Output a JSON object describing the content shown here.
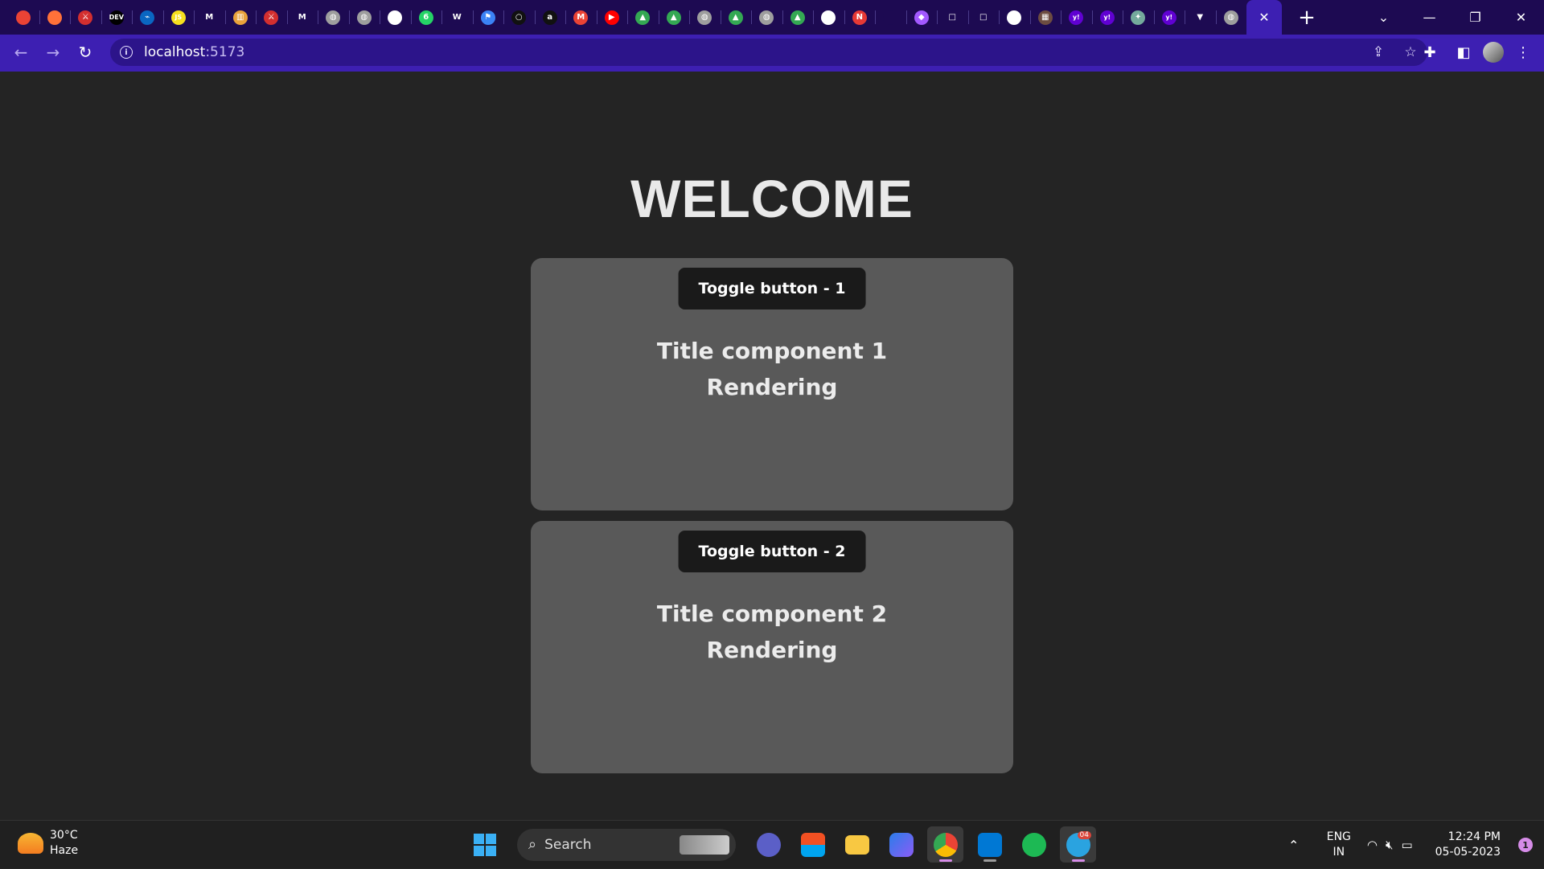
{
  "browser": {
    "tabs": [
      {
        "icon": "chrome-icon",
        "color": "#ea4335",
        "glyph": ""
      },
      {
        "icon": "firefox-icon",
        "color": "#ff7139",
        "glyph": ""
      },
      {
        "icon": "figure-icon",
        "color": "#d32f2f",
        "glyph": "⚔"
      },
      {
        "icon": "dev-icon",
        "color": "#000000",
        "glyph": "DEV"
      },
      {
        "icon": "azure-icon",
        "color": "#0a66c2",
        "glyph": "⌁"
      },
      {
        "icon": "js-icon",
        "color": "#f7df1e",
        "glyph": "JS"
      },
      {
        "icon": "medium-icon",
        "color": "#1d0a52",
        "glyph": "M"
      },
      {
        "icon": "books-icon",
        "color": "#e9a23b",
        "glyph": "▥"
      },
      {
        "icon": "figure-icon",
        "color": "#d32f2f",
        "glyph": "⚔"
      },
      {
        "icon": "medium-icon",
        "color": "#1d0a52",
        "glyph": "M"
      },
      {
        "icon": "globe-icon",
        "color": "#9e9e9e",
        "glyph": "◍"
      },
      {
        "icon": "globe-icon",
        "color": "#9e9e9e",
        "glyph": "◍"
      },
      {
        "icon": "github-icon",
        "color": "#ffffff",
        "glyph": "●"
      },
      {
        "icon": "whatsapp-icon",
        "color": "#25d366",
        "glyph": "6"
      },
      {
        "icon": "w-icon",
        "color": "#1d0a52",
        "glyph": "W"
      },
      {
        "icon": "flag-icon",
        "color": "#3b82f6",
        "glyph": "⚑"
      },
      {
        "icon": "circle-icon",
        "color": "#111111",
        "glyph": "○"
      },
      {
        "icon": "amazon-icon",
        "color": "#111111",
        "glyph": "a"
      },
      {
        "icon": "gmail-icon",
        "color": "#ea4335",
        "glyph": "M"
      },
      {
        "icon": "youtube-icon",
        "color": "#ff0000",
        "glyph": "▶"
      },
      {
        "icon": "drive-icon",
        "color": "#34a853",
        "glyph": "▲"
      },
      {
        "icon": "drive-icon",
        "color": "#34a853",
        "glyph": "▲"
      },
      {
        "icon": "globe-icon",
        "color": "#9e9e9e",
        "glyph": "◍"
      },
      {
        "icon": "drive-icon",
        "color": "#34a853",
        "glyph": "▲"
      },
      {
        "icon": "globe-icon",
        "color": "#9e9e9e",
        "glyph": "◍"
      },
      {
        "icon": "drive-icon",
        "color": "#34a853",
        "glyph": "▲"
      },
      {
        "icon": "github-icon",
        "color": "#ffffff",
        "glyph": "●"
      },
      {
        "icon": "notion-icon",
        "color": "#e53935",
        "glyph": "N"
      },
      {
        "icon": "blank-icon",
        "color": "#1d0a52",
        "glyph": ""
      },
      {
        "icon": "figma-icon",
        "color": "#a259ff",
        "glyph": "◆"
      },
      {
        "icon": "square-icon",
        "color": "#1d0a52",
        "glyph": "□"
      },
      {
        "icon": "square-icon",
        "color": "#1d0a52",
        "glyph": "□"
      },
      {
        "icon": "github-icon",
        "color": "#ffffff",
        "glyph": "●"
      },
      {
        "icon": "photo-icon",
        "color": "#6d4c41",
        "glyph": "▦"
      },
      {
        "icon": "yahoo-icon",
        "color": "#6001d2",
        "glyph": "y!"
      },
      {
        "icon": "yahoo-icon",
        "color": "#6001d2",
        "glyph": "y!"
      },
      {
        "icon": "chatgpt-icon",
        "color": "#74aa9c",
        "glyph": "✦"
      },
      {
        "icon": "yahoo-icon",
        "color": "#6001d2",
        "glyph": "y!"
      },
      {
        "icon": "vite-icon",
        "color": "#1d0a52",
        "glyph": "▼"
      },
      {
        "icon": "globe-icon",
        "color": "#9e9e9e",
        "glyph": "◍"
      }
    ],
    "active_tab_close": "✕",
    "new_tab": "+",
    "url_host": "localhost",
    "url_port": ":5173"
  },
  "page": {
    "heading": "WELCOME",
    "cards": [
      {
        "button": "Toggle button - 1",
        "title_line1": "Title component 1",
        "title_line2": "Rendering"
      },
      {
        "button": "Toggle button - 2",
        "title_line1": "Title component 2",
        "title_line2": "Rendering"
      }
    ]
  },
  "taskbar": {
    "weather_temp": "30°C",
    "weather_desc": "Haze",
    "search_label": "Search",
    "lang_line1": "ENG",
    "lang_line2": "IN",
    "time": "12:24 PM",
    "date": "05-05-2023",
    "notifications": "1",
    "telegram_badge": "04"
  }
}
